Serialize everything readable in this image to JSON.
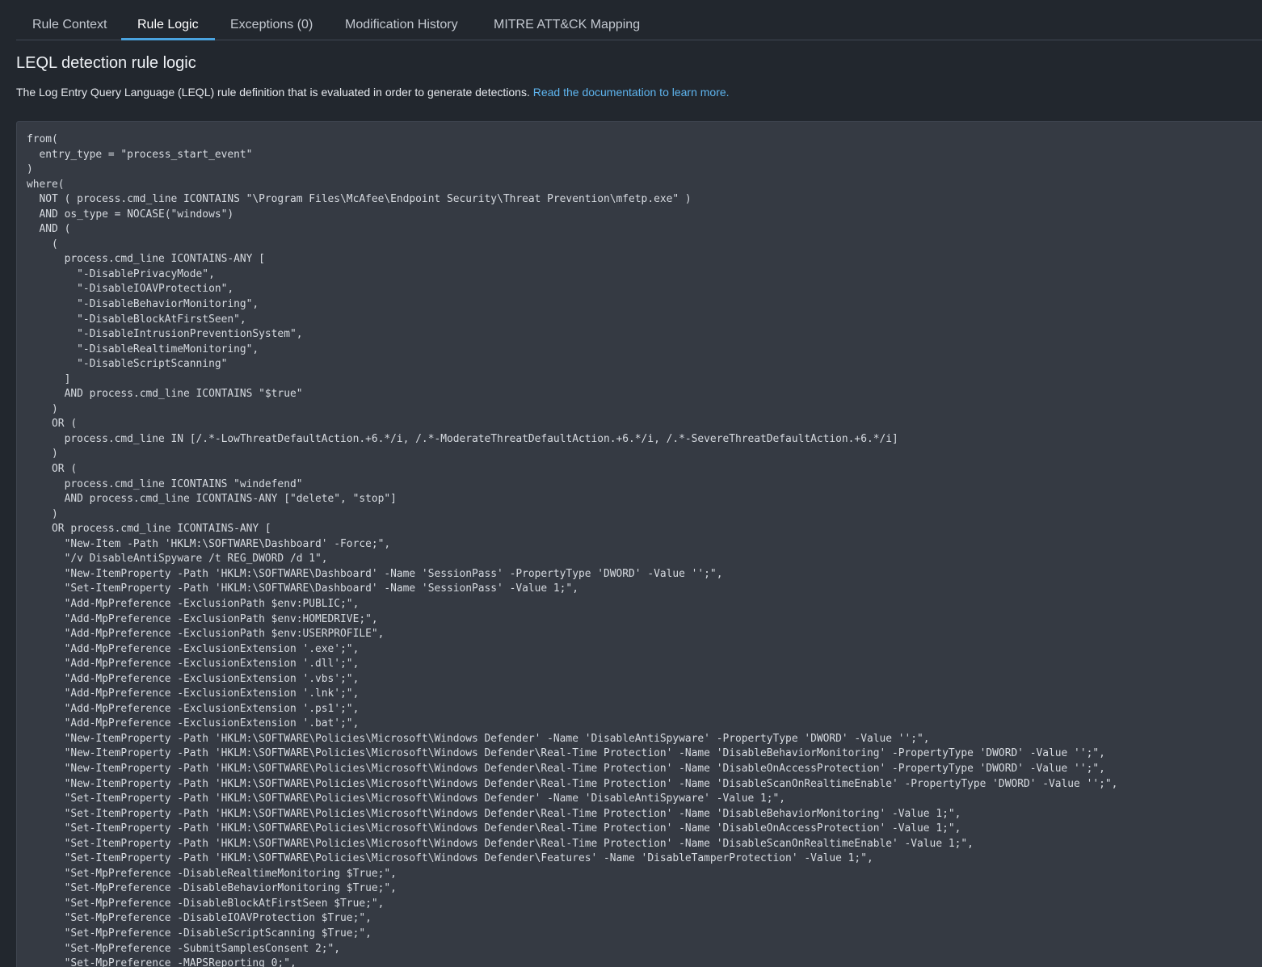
{
  "tabs": [
    {
      "label": "Rule Context",
      "active": false
    },
    {
      "label": "Rule Logic",
      "active": true
    },
    {
      "label": "Exceptions (0)",
      "active": false
    },
    {
      "label": "Modification History",
      "active": false
    },
    {
      "label": "MITRE ATT&CK Mapping",
      "active": false
    }
  ],
  "section": {
    "title": "LEQL detection rule logic",
    "description": "The Log Entry Query Language (LEQL) rule definition that is evaluated in order to generate detections. ",
    "doc_link_label": "Read the documentation to learn more."
  },
  "colors": {
    "background": "#22272e",
    "code_panel": "#353a43",
    "accent": "#4aa3df",
    "link": "#5eb4ee"
  },
  "code": {
    "content": "from(\n  entry_type = \"process_start_event\"\n)\nwhere(\n  NOT ( process.cmd_line ICONTAINS \"\\Program Files\\McAfee\\Endpoint Security\\Threat Prevention\\mfetp.exe\" )\n  AND os_type = NOCASE(\"windows\")\n  AND (\n    (\n      process.cmd_line ICONTAINS-ANY [\n        \"-DisablePrivacyMode\",\n        \"-DisableIOAVProtection\",\n        \"-DisableBehaviorMonitoring\",\n        \"-DisableBlockAtFirstSeen\",\n        \"-DisableIntrusionPreventionSystem\",\n        \"-DisableRealtimeMonitoring\",\n        \"-DisableScriptScanning\"\n      ]\n      AND process.cmd_line ICONTAINS \"$true\"\n    )\n    OR (\n      process.cmd_line IN [/.*-LowThreatDefaultAction.+6.*/i, /.*-ModerateThreatDefaultAction.+6.*/i, /.*-SevereThreatDefaultAction.+6.*/i]\n    )\n    OR (\n      process.cmd_line ICONTAINS \"windefend\"\n      AND process.cmd_line ICONTAINS-ANY [\"delete\", \"stop\"]\n    )\n    OR process.cmd_line ICONTAINS-ANY [\n      \"New-Item -Path 'HKLM:\\SOFTWARE\\Dashboard' -Force;\",\n      \"/v DisableAntiSpyware /t REG_DWORD /d 1\",\n      \"New-ItemProperty -Path 'HKLM:\\SOFTWARE\\Dashboard' -Name 'SessionPass' -PropertyType 'DWORD' -Value '';\",\n      \"Set-ItemProperty -Path 'HKLM:\\SOFTWARE\\Dashboard' -Name 'SessionPass' -Value 1;\",\n      \"Add-MpPreference -ExclusionPath $env:PUBLIC;\",\n      \"Add-MpPreference -ExclusionPath $env:HOMEDRIVE;\",\n      \"Add-MpPreference -ExclusionPath $env:USERPROFILE\",\n      \"Add-MpPreference -ExclusionExtension '.exe';\",\n      \"Add-MpPreference -ExclusionExtension '.dll';\",\n      \"Add-MpPreference -ExclusionExtension '.vbs';\",\n      \"Add-MpPreference -ExclusionExtension '.lnk';\",\n      \"Add-MpPreference -ExclusionExtension '.ps1';\",\n      \"Add-MpPreference -ExclusionExtension '.bat';\",\n      \"New-ItemProperty -Path 'HKLM:\\SOFTWARE\\Policies\\Microsoft\\Windows Defender' -Name 'DisableAntiSpyware' -PropertyType 'DWORD' -Value '';\",\n      \"New-ItemProperty -Path 'HKLM:\\SOFTWARE\\Policies\\Microsoft\\Windows Defender\\Real-Time Protection' -Name 'DisableBehaviorMonitoring' -PropertyType 'DWORD' -Value '';\",\n      \"New-ItemProperty -Path 'HKLM:\\SOFTWARE\\Policies\\Microsoft\\Windows Defender\\Real-Time Protection' -Name 'DisableOnAccessProtection' -PropertyType 'DWORD' -Value '';\",\n      \"New-ItemProperty -Path 'HKLM:\\SOFTWARE\\Policies\\Microsoft\\Windows Defender\\Real-Time Protection' -Name 'DisableScanOnRealtimeEnable' -PropertyType 'DWORD' -Value '';\",\n      \"Set-ItemProperty -Path 'HKLM:\\SOFTWARE\\Policies\\Microsoft\\Windows Defender' -Name 'DisableAntiSpyware' -Value 1;\",\n      \"Set-ItemProperty -Path 'HKLM:\\SOFTWARE\\Policies\\Microsoft\\Windows Defender\\Real-Time Protection' -Name 'DisableBehaviorMonitoring' -Value 1;\",\n      \"Set-ItemProperty -Path 'HKLM:\\SOFTWARE\\Policies\\Microsoft\\Windows Defender\\Real-Time Protection' -Name 'DisableOnAccessProtection' -Value 1;\",\n      \"Set-ItemProperty -Path 'HKLM:\\SOFTWARE\\Policies\\Microsoft\\Windows Defender\\Real-Time Protection' -Name 'DisableScanOnRealtimeEnable' -Value 1;\",\n      \"Set-ItemProperty -Path 'HKLM:\\SOFTWARE\\Policies\\Microsoft\\Windows Defender\\Features' -Name 'DisableTamperProtection' -Value 1;\",\n      \"Set-MpPreference -DisableRealtimeMonitoring $True;\",\n      \"Set-MpPreference -DisableBehaviorMonitoring $True;\",\n      \"Set-MpPreference -DisableBlockAtFirstSeen $True;\",\n      \"Set-MpPreference -DisableIOAVProtection $True;\",\n      \"Set-MpPreference -DisableScriptScanning $True;\",\n      \"Set-MpPreference -SubmitSamplesConsent 2;\",\n      \"Set-MpPreference -MAPSReporting 0;\","
  }
}
